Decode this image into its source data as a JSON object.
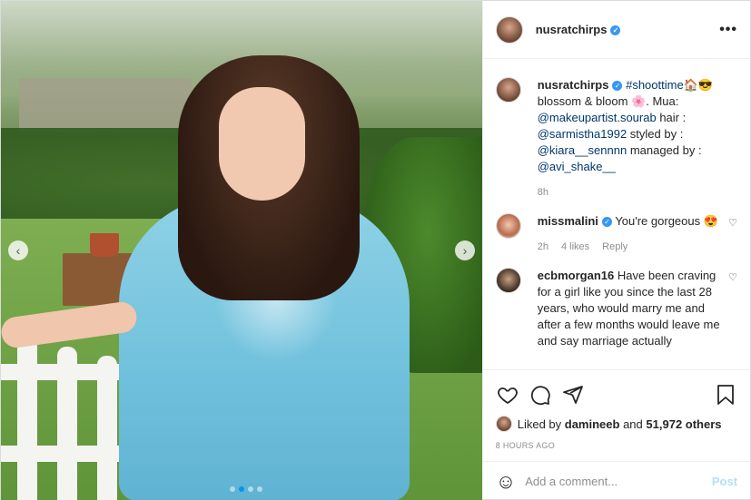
{
  "header": {
    "username": "nusratchirps"
  },
  "caption": {
    "username": "nusratchirps",
    "hashtag": "#shoottime",
    "emoji1": "🏠😎",
    "text1": "blossom & bloom",
    "emoji2": "🌸",
    "text2": ". Mua:",
    "mention1": "@makeupartist.sourab",
    "text3": " hair :",
    "mention2": "@sarmistha1992",
    "text4": " styled by :",
    "mention3": "@kiara__sennnn",
    "text5": " managed by :",
    "mention4": "@avi_shake__",
    "time": "8h"
  },
  "comments": [
    {
      "user": "missmalini",
      "text": "You're gorgeous 😍",
      "time": "2h",
      "likes": "4 likes",
      "reply": "Reply"
    },
    {
      "user": "ecbmorgan16",
      "text": "Have been craving for a girl like you since the last 28 years, who would marry me and after a few months would leave me and say marriage actually"
    }
  ],
  "likes": {
    "prefix": "Liked by",
    "user": "damineeb",
    "connector": "and",
    "count": "51,972 others"
  },
  "timestamp": "8 HOURS AGO",
  "comment_box": {
    "placeholder": "Add a comment...",
    "post_label": "Post"
  },
  "icons": {
    "more": "more-options-icon",
    "like": "heart-icon",
    "comment": "comment-icon",
    "share": "share-icon",
    "save": "bookmark-icon",
    "emoji": "emoji-icon"
  },
  "colors": {
    "verified": "#3897f0",
    "link": "#00376b",
    "post_disabled": "#b2dffc",
    "carousel_active": "#0095f6"
  }
}
